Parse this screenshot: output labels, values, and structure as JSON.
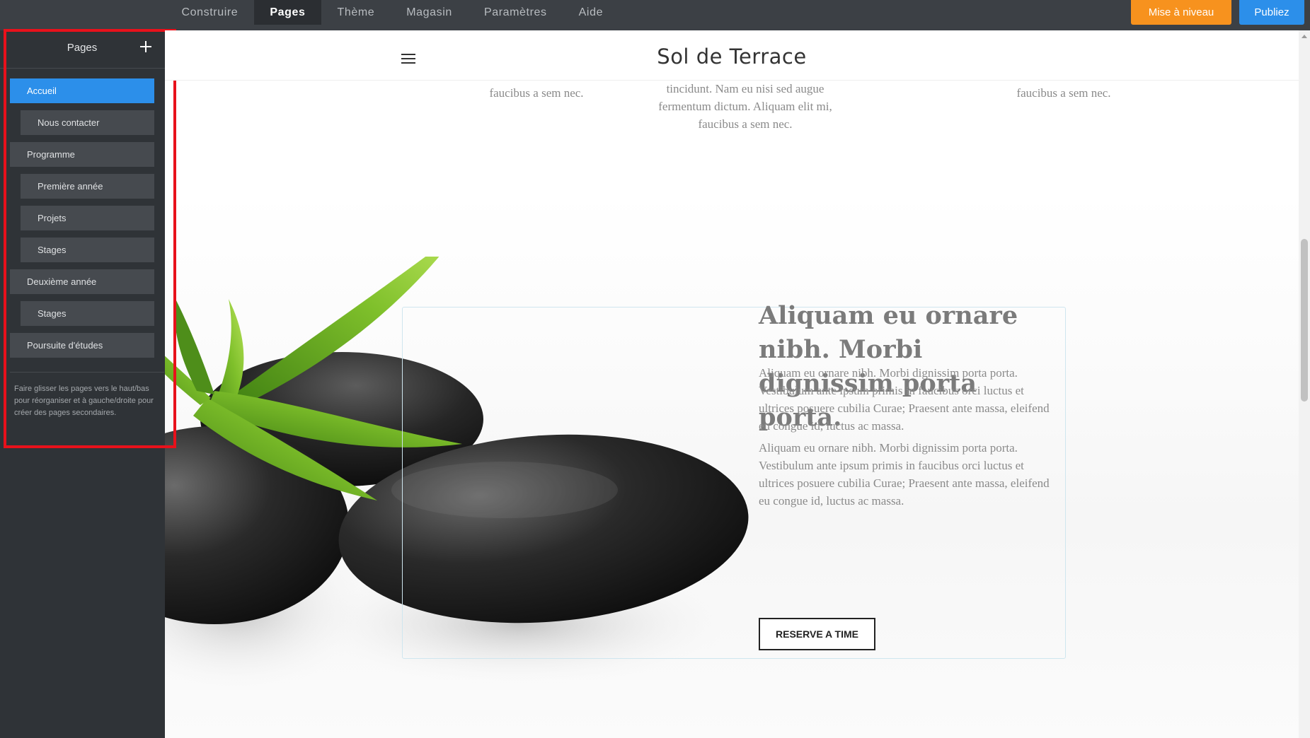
{
  "topbar": {
    "tabs": [
      {
        "label": "Construire"
      },
      {
        "label": "Pages"
      },
      {
        "label": "Thème"
      },
      {
        "label": "Magasin"
      },
      {
        "label": "Paramètres"
      },
      {
        "label": "Aide"
      }
    ],
    "active_tab": "Pages",
    "upgrade_label": "Mise à niveau",
    "publish_label": "Publiez"
  },
  "sidebar": {
    "title": "Pages",
    "add_icon": "plus-icon",
    "pages": [
      {
        "label": "Accueil",
        "level": "top",
        "active": true
      },
      {
        "label": "Nous contacter",
        "level": "sub"
      },
      {
        "label": "Programme",
        "level": "top"
      },
      {
        "label": "Première année",
        "level": "sub"
      },
      {
        "label": "Projets",
        "level": "sub"
      },
      {
        "label": "Stages",
        "level": "sub"
      },
      {
        "label": "Deuxième année",
        "level": "top"
      },
      {
        "label": "Stages",
        "level": "sub"
      },
      {
        "label": "Poursuite d'études",
        "level": "top"
      }
    ],
    "help_text": "Faire glisser les pages vers le haut/bas pour réorganiser et à gauche/droite pour créer des pages secondaires."
  },
  "site": {
    "title": "Sol de Terrace",
    "menu_icon": "hamburger-icon",
    "columns": [
      {
        "text": "faucibus a sem nec."
      },
      {
        "line1": "tincidunt. Nam eu nisi sed augue",
        "line2": "fermentum dictum. Aliquam elit mi,",
        "line3": "faucibus a sem nec."
      },
      {
        "text": "faucibus a sem nec."
      }
    ],
    "feature": {
      "heading": "Aliquam eu ornare nibh. Morbi dignissim porta porta.",
      "paragraphs": [
        "Aliquam eu ornare nibh. Morbi dignissim porta porta. Vestibulum ante ipsum primis in faucibus orci luctus et ultrices posuere cubilia Curae; Praesent ante massa, eleifend eu congue id, luctus ac massa.",
        "Aliquam eu ornare nibh. Morbi dignissim porta porta. Vestibulum ante ipsum primis in faucibus orci luctus et ultrices posuere cubilia Curae; Praesent ante massa, eleifend eu congue id, luctus ac massa."
      ],
      "button_label": "RESERVE A TIME",
      "image": "bamboo-stones-image"
    }
  },
  "colors": {
    "topbar": "#3c4045",
    "sidebar": "#2f3337",
    "accent_blue": "#2c8fea",
    "upgrade_orange": "#f7921e",
    "highlight_red": "#e8111b"
  }
}
